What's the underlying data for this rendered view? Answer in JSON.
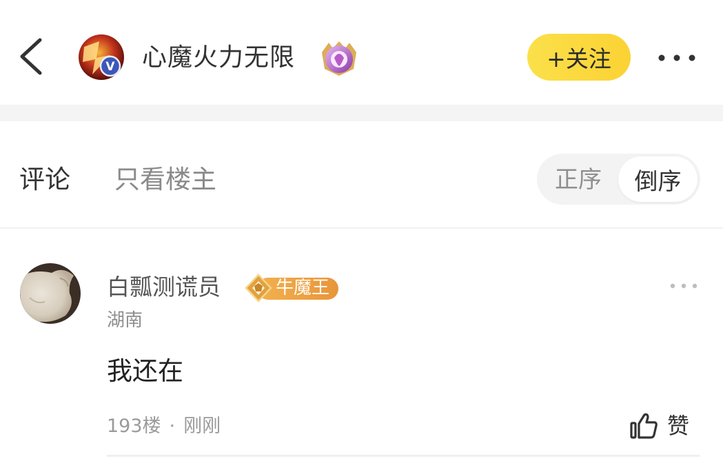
{
  "header": {
    "title": "心魔火力无限",
    "follow_label": "+关注",
    "accent_color": "#fbd93c"
  },
  "tabs": {
    "comments": "评论",
    "owner_only": "只看楼主"
  },
  "sort": {
    "ascending": "正序",
    "descending": "倒序",
    "selected": "倒序"
  },
  "comment": {
    "username": "白瓢测谎员",
    "level_badge": "牛魔王",
    "location": "湖南",
    "text": "我还在",
    "floor": "193楼",
    "separator": "·",
    "time": "刚刚",
    "like_label": "赞"
  },
  "icons": {
    "back": "chevron-left-icon",
    "more": "more-horizontal-icon",
    "like": "thumbs-up-icon",
    "verified": "v-badge-icon"
  }
}
